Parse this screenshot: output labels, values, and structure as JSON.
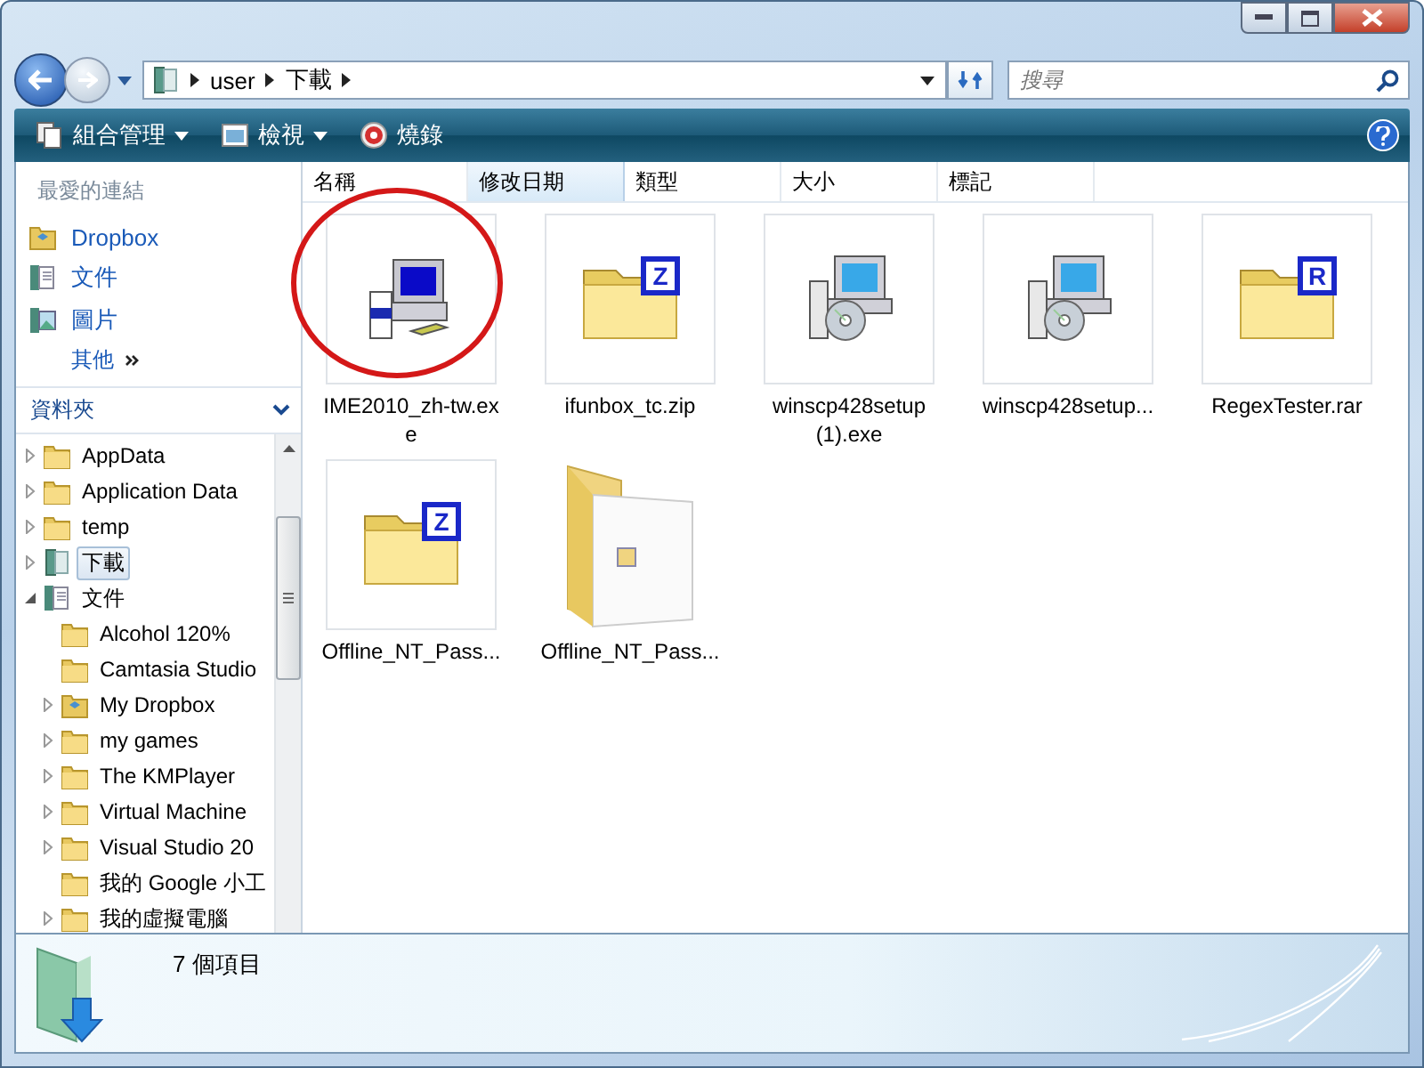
{
  "address": {
    "segments": [
      "user",
      "下載"
    ]
  },
  "search": {
    "placeholder": "搜尋"
  },
  "toolbar": {
    "items": [
      {
        "label": "組合管理",
        "kind": "organize",
        "dropdown": true
      },
      {
        "label": "檢視",
        "kind": "views",
        "dropdown": true
      },
      {
        "label": "燒錄",
        "kind": "burn",
        "dropdown": false
      }
    ]
  },
  "favorites": {
    "title": "最愛的連結",
    "items": [
      {
        "label": "Dropbox",
        "kind": "dropbox"
      },
      {
        "label": "文件",
        "kind": "documents"
      },
      {
        "label": "圖片",
        "kind": "pictures"
      }
    ],
    "more": "其他"
  },
  "folders": {
    "title": "資料夾",
    "items": [
      {
        "label": "AppData",
        "kind": "folder",
        "has_children": true,
        "expanded": false,
        "selected": false
      },
      {
        "label": "Application Data",
        "kind": "folder",
        "has_children": true,
        "expanded": false,
        "selected": false
      },
      {
        "label": "temp",
        "kind": "folder",
        "has_children": true,
        "expanded": false,
        "selected": false
      },
      {
        "label": "下載",
        "kind": "library",
        "has_children": true,
        "expanded": false,
        "selected": true
      },
      {
        "label": "文件",
        "kind": "documents",
        "has_children": true,
        "expanded": true,
        "selected": false,
        "children": [
          {
            "label": "Alcohol 120%",
            "kind": "folder",
            "has_children": false,
            "selected": false
          },
          {
            "label": "Camtasia Studio",
            "kind": "folder",
            "has_children": false,
            "selected": false
          },
          {
            "label": "My Dropbox",
            "kind": "dropbox",
            "has_children": true,
            "expanded": false,
            "selected": false
          },
          {
            "label": "my games",
            "kind": "folder",
            "has_children": true,
            "expanded": false,
            "selected": false
          },
          {
            "label": "The KMPlayer",
            "kind": "folder",
            "has_children": true,
            "expanded": false,
            "selected": false
          },
          {
            "label": "Virtual Machine",
            "kind": "folder",
            "has_children": true,
            "expanded": false,
            "selected": false
          },
          {
            "label": "Visual Studio 20",
            "kind": "folder",
            "has_children": true,
            "expanded": false,
            "selected": false
          },
          {
            "label": "我的 Google 小工",
            "kind": "folder",
            "has_children": false,
            "selected": false
          },
          {
            "label": "我的虛擬電腦",
            "kind": "folder",
            "has_children": true,
            "expanded": false,
            "selected": false
          }
        ]
      }
    ]
  },
  "columns": [
    {
      "label": "名稱",
      "selected": false
    },
    {
      "label": "修改日期",
      "selected": true
    },
    {
      "label": "類型",
      "selected": false
    },
    {
      "label": "大小",
      "selected": false
    },
    {
      "label": "標記",
      "selected": false
    }
  ],
  "files": [
    {
      "name": "IME2010_zh-tw.exe",
      "kind": "installer"
    },
    {
      "name": "ifunbox_tc.zip",
      "kind": "archive",
      "badge": "Z"
    },
    {
      "name": "winscp428setup (1).exe",
      "kind": "setup"
    },
    {
      "name": "winscp428setup...",
      "kind": "setup"
    },
    {
      "name": "RegexTester.rar",
      "kind": "archive",
      "badge": "R"
    },
    {
      "name": "Offline_NT_Pass...",
      "kind": "archive",
      "badge": "Z"
    },
    {
      "name": "Offline_NT_Pass...",
      "kind": "folder"
    }
  ],
  "status": {
    "count": "7 個項目"
  }
}
